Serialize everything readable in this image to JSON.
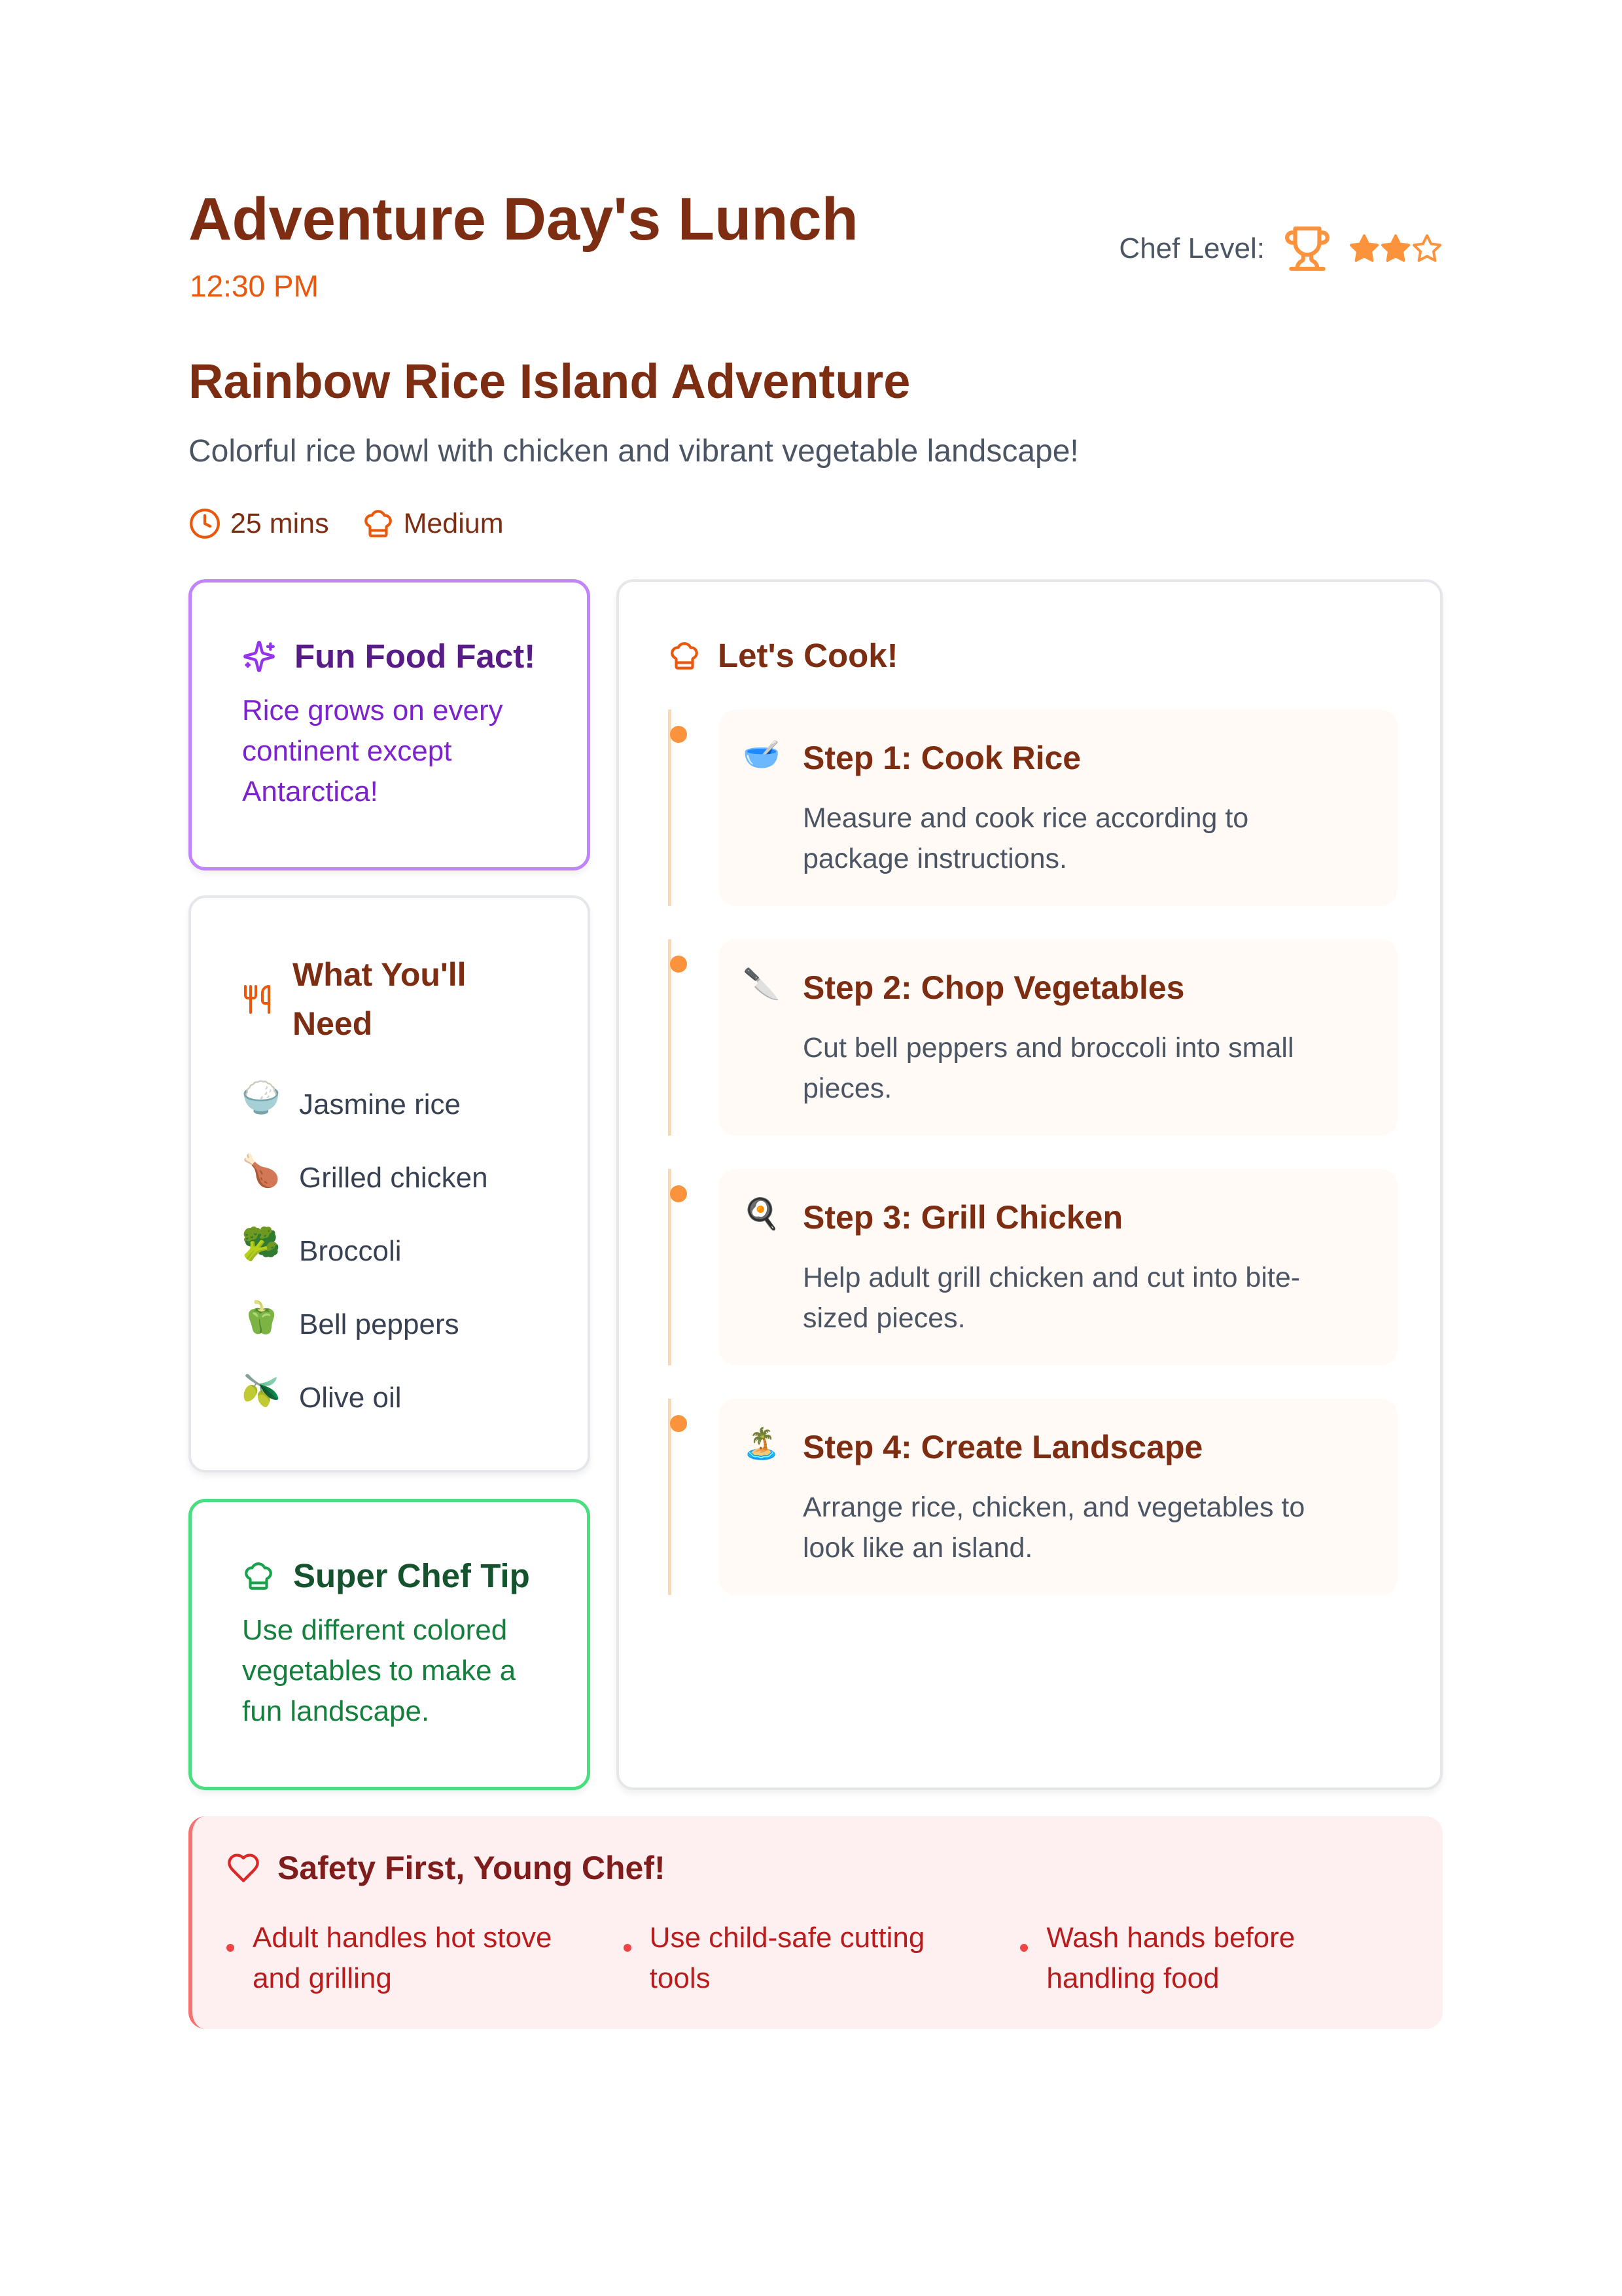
{
  "header": {
    "title": "Adventure Day's Lunch",
    "time": "12:30 PM",
    "chef_level_label": "Chef Level:",
    "chef_level_icon": "trophy-icon",
    "chef_level_rating": 2,
    "chef_level_max": 3
  },
  "recipe": {
    "title": "Rainbow Rice Island Adventure",
    "description": "Colorful rice bowl with chicken and vibrant vegetable landscape!",
    "duration": "25 mins",
    "duration_icon": "clock-icon",
    "difficulty": "Medium",
    "difficulty_icon": "chef-hat-icon"
  },
  "fun_fact": {
    "icon": "sparkles-icon",
    "title": "Fun Food Fact!",
    "text": "Rice grows on every continent except Antarctica!"
  },
  "ingredients": {
    "icon": "utensils-icon",
    "title": "What You'll Need",
    "items": [
      {
        "emoji": "🍚",
        "label": "Jasmine rice"
      },
      {
        "emoji": "🍗",
        "label": "Grilled chicken"
      },
      {
        "emoji": "🥦",
        "label": "Broccoli"
      },
      {
        "emoji": "🫑",
        "label": "Bell peppers"
      },
      {
        "emoji": "🫒",
        "label": "Olive oil"
      }
    ]
  },
  "tip": {
    "icon": "chef-hat-icon",
    "title": "Super Chef Tip",
    "text": "Use different colored vegetables to make a fun landscape."
  },
  "steps": {
    "icon": "chef-hat-icon",
    "title": "Let's Cook!",
    "items": [
      {
        "emoji": "🥣",
        "title": "Step 1: Cook Rice",
        "description": "Measure and cook rice according to package instructions."
      },
      {
        "emoji": "🔪",
        "title": "Step 2: Chop Vegetables",
        "description": "Cut bell peppers and broccoli into small pieces."
      },
      {
        "emoji": "🍳",
        "title": "Step 3: Grill Chicken",
        "description": "Help adult grill chicken and cut into bite-sized pieces."
      },
      {
        "emoji": "🏝️",
        "title": "Step 4: Create Landscape",
        "description": "Arrange rice, chicken, and vegetables to look like an island."
      }
    ]
  },
  "safety": {
    "icon": "heart-icon",
    "title": "Safety First, Young Chef!",
    "items": [
      "Adult handles hot stove and grilling",
      "Use child-safe cutting tools",
      "Wash hands before handling food"
    ]
  },
  "colors": {
    "brand_brown": "#7c2d12",
    "accent_orange": "#ea580c",
    "star_orange": "#fb923c",
    "fact_purple": "#7e22ce",
    "tip_green": "#15803d",
    "safety_red": "#b91c1c"
  }
}
